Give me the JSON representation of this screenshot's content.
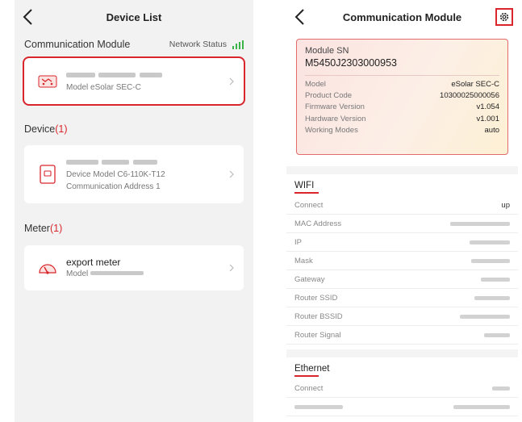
{
  "left": {
    "header": {
      "title": "Device List"
    },
    "comm": {
      "section_title": "Communication Module",
      "network_label": "Network Status",
      "model_text": "Model  eSolar SEC-C"
    },
    "device": {
      "section_title": "Device",
      "count": "(1)",
      "model_text": "Device Model  C6-110K-T12",
      "address_text": "Communication Address  1"
    },
    "meter": {
      "section_title": "Meter",
      "count": "(1)",
      "name": "export meter",
      "model_label": "Model"
    }
  },
  "right": {
    "header": {
      "title": "Communication Module"
    },
    "sn": {
      "label": "Module SN",
      "value": "M5450J2303000953",
      "fields": [
        {
          "k": "Model",
          "v": "eSolar SEC-C"
        },
        {
          "k": "Product Code",
          "v": "10300025000056"
        },
        {
          "k": "Firmware Version",
          "v": "v1.054"
        },
        {
          "k": "Hardware Version",
          "v": "v1.001"
        },
        {
          "k": "Working Modes",
          "v": "auto"
        }
      ]
    },
    "wifi": {
      "title": "WIFI",
      "rows": [
        {
          "k": "Connect",
          "v": "up"
        },
        {
          "k": "MAC Address",
          "v": ""
        },
        {
          "k": "IP",
          "v": ""
        },
        {
          "k": "Mask",
          "v": ""
        },
        {
          "k": "Gateway",
          "v": ""
        },
        {
          "k": "Router SSID",
          "v": ""
        },
        {
          "k": "Router BSSID",
          "v": ""
        },
        {
          "k": "Router Signal",
          "v": ""
        }
      ]
    },
    "ethernet": {
      "title": "Ethernet",
      "rows": [
        {
          "k": "Connect",
          "v": ""
        }
      ]
    }
  },
  "colors": {
    "accent_red": "#d9262c",
    "signal_green": "#3cb44a"
  }
}
